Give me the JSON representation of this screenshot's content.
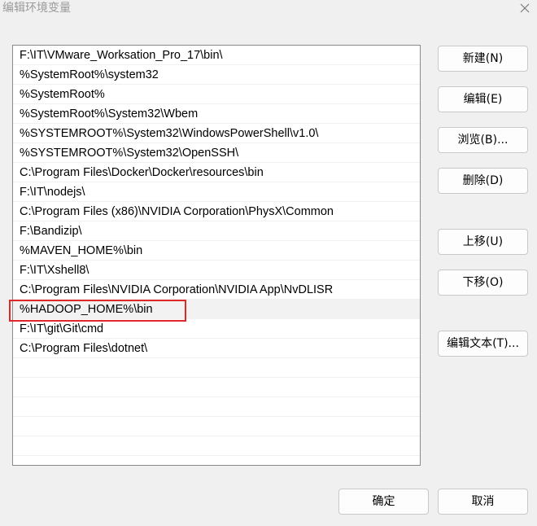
{
  "window": {
    "title": "编辑环境变量"
  },
  "icons": {
    "close": "close-icon"
  },
  "paths": [
    "F:\\IT\\VMware_Worksation_Pro_17\\bin\\",
    "%SystemRoot%\\system32",
    "%SystemRoot%",
    "%SystemRoot%\\System32\\Wbem",
    "%SYSTEMROOT%\\System32\\WindowsPowerShell\\v1.0\\",
    "%SYSTEMROOT%\\System32\\OpenSSH\\",
    "C:\\Program Files\\Docker\\Docker\\resources\\bin",
    "F:\\IT\\nodejs\\",
    "C:\\Program Files (x86)\\NVIDIA Corporation\\PhysX\\Common",
    "F:\\Bandizip\\",
    "%MAVEN_HOME%\\bin",
    "F:\\IT\\Xshell8\\",
    "C:\\Program Files\\NVIDIA Corporation\\NVIDIA App\\NvDLISR",
    "%HADOOP_HOME%\\bin",
    "F:\\IT\\git\\Git\\cmd",
    "C:\\Program Files\\dotnet\\"
  ],
  "selected_index": 13,
  "buttons": {
    "new": "新建(N)",
    "edit": "编辑(E)",
    "browse": "浏览(B)...",
    "delete": "删除(D)",
    "move_up": "上移(U)",
    "move_down": "下移(O)",
    "edit_text": "编辑文本(T)...",
    "ok": "确定",
    "cancel": "取消"
  },
  "colors": {
    "highlight_border": "#e0282b",
    "selected_row": "#f2f2f2"
  }
}
